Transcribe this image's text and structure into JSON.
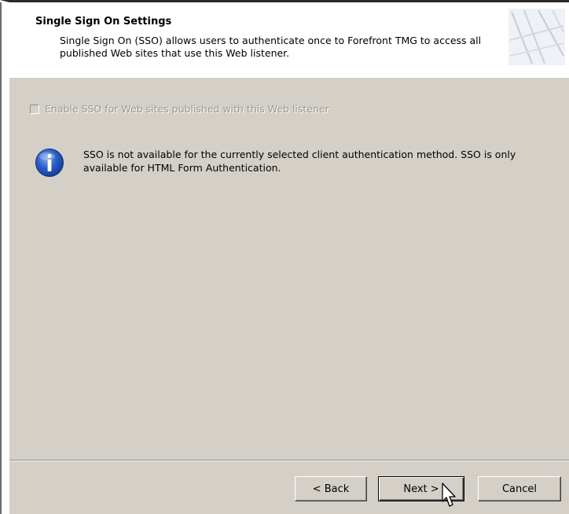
{
  "header": {
    "title": "Single Sign On Settings",
    "subtitle": "Single Sign On (SSO) allows users to authenticate once to Forefront TMG to access all published Web sites that use this Web listener."
  },
  "sso": {
    "checkbox_label": "Enable SSO for Web sites published with this Web listener",
    "checked": false,
    "enabled": false
  },
  "info": {
    "icon": "info-icon",
    "message": "SSO is not available for the currently selected client authentication method. SSO is only available for HTML Form Authentication."
  },
  "buttons": {
    "back": "< Back",
    "next": "Next >",
    "cancel": "Cancel"
  },
  "colors": {
    "dialog_bg": "#d4d0c8",
    "header_bg": "#ffffff",
    "info_icon_blue": "#1f4fb8",
    "disabled_text": "#9a9690"
  }
}
